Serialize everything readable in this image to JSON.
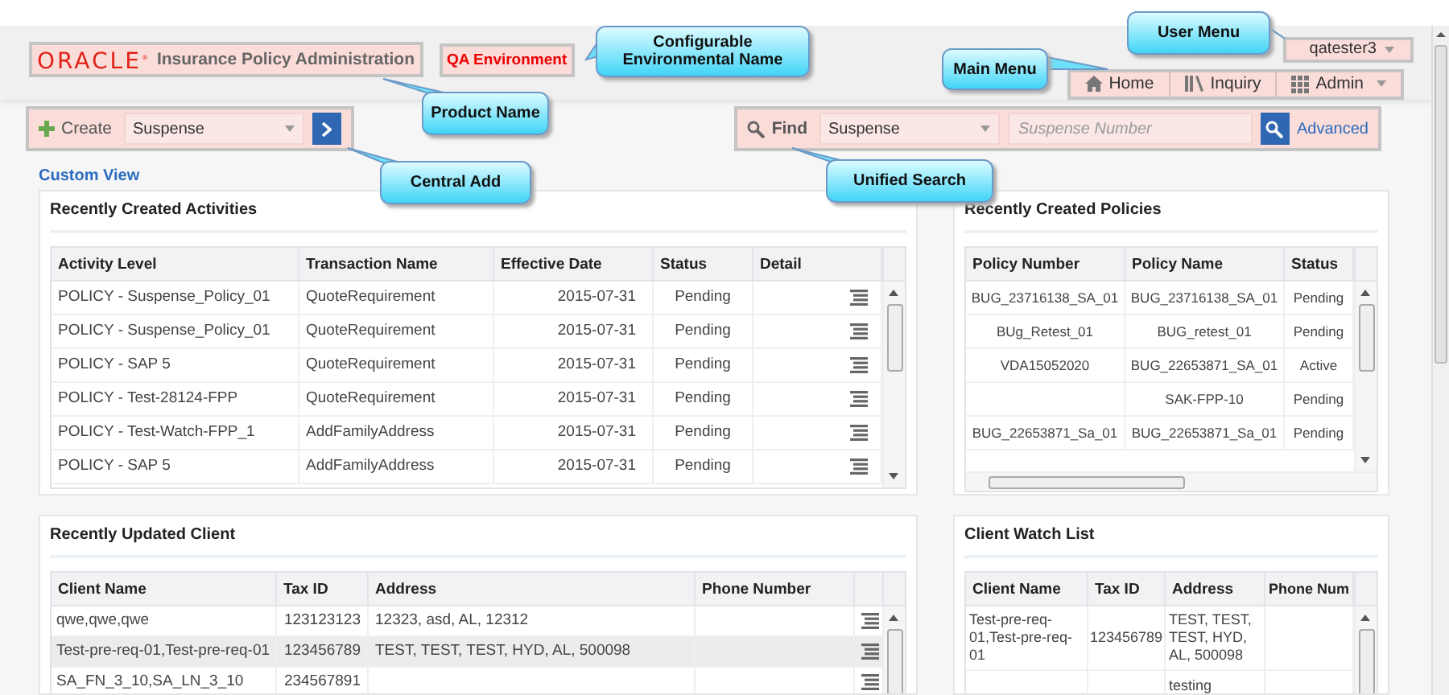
{
  "header": {
    "logo": "ORACLE$^{®}$",
    "product_name": "Insurance Policy Administration",
    "environment": "QA Environment",
    "user_menu": "qatester3",
    "main_menu": [
      {
        "kind": "home",
        "label": "Home",
        "dropdown": false
      },
      {
        "kind": "inquiry",
        "label": "Inquiry",
        "dropdown": false
      },
      {
        "kind": "admin",
        "label": "Admin",
        "dropdown": true
      }
    ]
  },
  "create": {
    "label": "Create",
    "value": "Suspense"
  },
  "find": {
    "label": "Find",
    "value": "Suspense",
    "placeholder": "Suspense Number",
    "advanced": "Advanced"
  },
  "custom_view": "Custom View",
  "panels": [
    {
      "title": "Recently Created Activities",
      "row_menu": true,
      "columns": [
        "Activity Level",
        "Transaction Name",
        "Effective Date",
        "Status",
        "Detail"
      ],
      "rows": [
        {
          "cells": [
            "POLICY - Suspense_Policy_01",
            "QuoteRequirement",
            "2015-07-31",
            "Pending"
          ],
          "selected": false
        },
        {
          "cells": [
            "POLICY - Suspense_Policy_01",
            "QuoteRequirement",
            "2015-07-31",
            "Pending"
          ],
          "selected": false
        },
        {
          "cells": [
            "POLICY - SAP 5",
            "QuoteRequirement",
            "2015-07-31",
            "Pending"
          ],
          "selected": false
        },
        {
          "cells": [
            "POLICY - Test-28124-FPP",
            "QuoteRequirement",
            "2015-07-31",
            "Pending"
          ],
          "selected": false
        },
        {
          "cells": [
            "POLICY - Test-Watch-FPP_1",
            "AddFamilyAddress",
            "2015-07-31",
            "Pending"
          ],
          "selected": false
        },
        {
          "cells": [
            "POLICY - SAP 5",
            "AddFamilyAddress",
            "2015-07-31",
            "Pending"
          ],
          "selected": false
        }
      ]
    },
    {
      "title": "Recently Created Policies",
      "columns": [
        "Policy Number",
        "Policy Name",
        "Status"
      ],
      "rows": [
        {
          "cells": [
            "BUG_23716138_SA_01",
            "BUG_23716138_SA_01",
            "Pending"
          ],
          "selected": false
        },
        {
          "cells": [
            "BUg_Retest_01",
            "BUG_retest_01",
            "Pending"
          ],
          "selected": false
        },
        {
          "cells": [
            "VDA15052020",
            "BUG_22653871_SA_01",
            "Active"
          ],
          "selected": false
        },
        {
          "cells": [
            null,
            "SAK-FPP-10",
            "Pending"
          ],
          "selected": false
        },
        {
          "cells": [
            "BUG_22653871_Sa_01",
            "BUG_22653871_Sa_01",
            "Pending"
          ],
          "selected": false
        }
      ]
    },
    {
      "title": "Recently Updated Client",
      "row_menu": true,
      "columns": [
        "Client Name",
        "Tax ID",
        "Address",
        "Phone Number"
      ],
      "rows": [
        {
          "cells": [
            "qwe,qwe,qwe",
            "123123123",
            "12323, asd, AL, 12312",
            null
          ],
          "selected": false
        },
        {
          "cells": [
            "Test-pre-req-01,Test-pre-req-01",
            "123456789",
            "TEST, TEST, TEST, HYD, AL, 500098",
            null
          ],
          "selected": true
        },
        {
          "cells": [
            "SA_FN_3_10,SA_LN_3_10",
            "234567891",
            null,
            null
          ],
          "selected": false
        }
      ]
    },
    {
      "title": "Client Watch List",
      "columns": [
        "Client Name",
        "Tax ID",
        "Address",
        "Phone Num"
      ],
      "rows": [
        {
          "cells": [
            "Test-pre-req-01,Test-pre-req-01",
            "123456789",
            "TEST, TEST, TEST, HYD, AL, 500098",
            null
          ],
          "selected": false
        },
        {
          "cells": [
            null,
            null,
            "testing",
            null
          ],
          "selected": false
        }
      ]
    }
  ],
  "callouts": [
    {
      "text": "Configurable Environmental Name"
    },
    {
      "text": "Product Name"
    },
    {
      "text": "Central Add"
    },
    {
      "text": "Main Menu"
    },
    {
      "text": "User Menu"
    },
    {
      "text": "Unified Search"
    }
  ]
}
